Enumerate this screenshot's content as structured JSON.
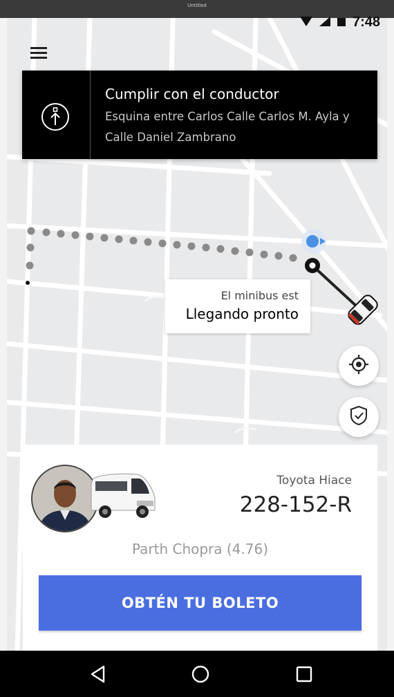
{
  "window": {
    "title": "Untitled"
  },
  "status_bar": {
    "time": "7:48"
  },
  "banner": {
    "title": "Cumplir con el conductor",
    "subtitle": "Esquina entre Carlos Calle Carlos M. Ayla y Calle Daniel Zambrano"
  },
  "eta": {
    "status": "El minibus est",
    "arrival": "Llegando pronto"
  },
  "vehicle": {
    "model": "Toyota Hiace",
    "plate": "228-152-R"
  },
  "driver": {
    "name_rating": "Parth Chopra (4.76)"
  },
  "cta": {
    "label": "OBTÉN TU BOLETO"
  },
  "colors": {
    "accent": "#4a6ee0",
    "banner": "#000000",
    "route_dots": "#8a8a8a",
    "user_location": "#4a90e2"
  },
  "icons": {
    "menu": "hamburger-icon",
    "banner": "walk-to-pickup-icon",
    "locate": "crosshair-icon",
    "safety": "shield-check-icon",
    "nav": [
      "back-triangle-icon",
      "home-circle-icon",
      "recents-square-icon"
    ]
  }
}
